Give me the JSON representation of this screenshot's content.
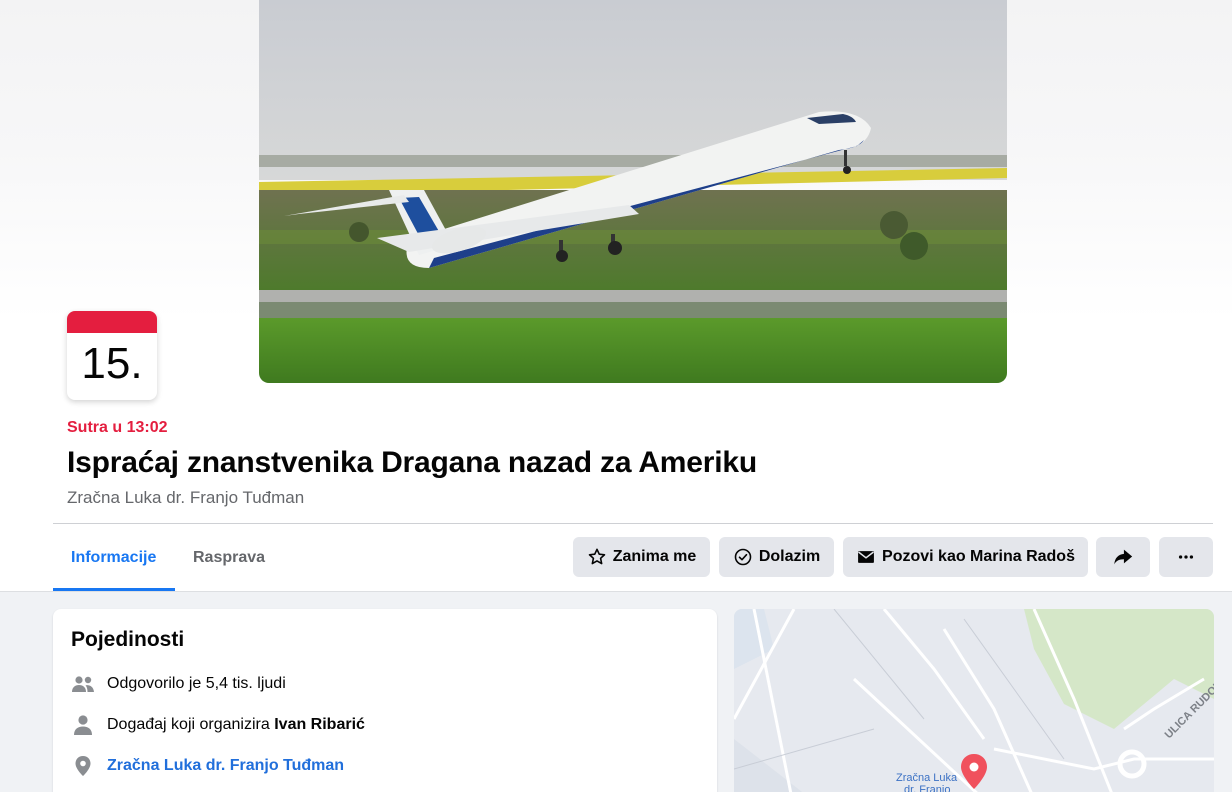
{
  "event": {
    "date_day": "15.",
    "time_label": "Sutra u 13:02",
    "title": "Ispraćaj znanstvenika Dragana nazad za Ameriku",
    "location": "Zračna Luka dr. Franjo Tuđman"
  },
  "tabs": [
    {
      "label": "Informacije",
      "active": true
    },
    {
      "label": "Rasprava",
      "active": false
    }
  ],
  "actions": {
    "interested_label": "Zanima me",
    "going_label": "Dolazim",
    "invite_label": "Pozovi kao Marina Radoš",
    "share_icon": "share-arrow-icon",
    "more_icon": "more-dots-icon"
  },
  "details": {
    "title": "Pojedinosti",
    "responded": "Odgovorilo je 5,4 tis. ljudi",
    "organizer_prefix": "Događaj koji organizira",
    "organizer_name": "Ivan Ribarić",
    "location_link": "Zračna Luka dr. Franjo Tuđman"
  },
  "map": {
    "street_label": "ULICA RUDOLF",
    "pin_label_line1": "Zračna Luka",
    "pin_label_line2": "dr. Franjo"
  },
  "colors": {
    "accent_blue": "#1877f2",
    "date_red": "#e41e3f",
    "button_gray": "#e4e6eb"
  }
}
